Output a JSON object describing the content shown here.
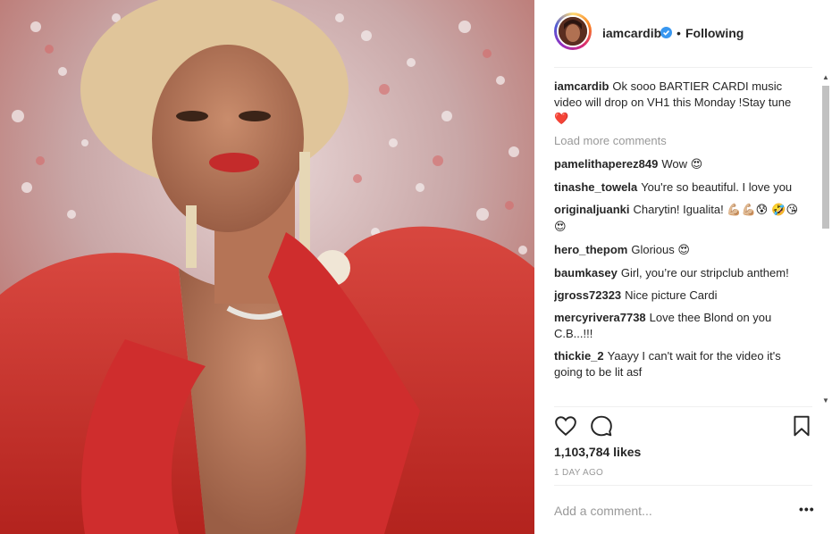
{
  "post": {
    "username": "iamcardib",
    "follow_status": "Following",
    "caption_user": "iamcardib",
    "caption_text": "Ok sooo BARTIER CARDI music video will drop on VH1 this Monday !Stay tune",
    "caption_emoji": "❤️",
    "load_more": "Load more comments",
    "likes": "1,103,784 likes",
    "time_ago": "1 DAY AGO",
    "add_comment_placeholder": "Add a comment...",
    "more_options": "•••"
  },
  "comments": [
    {
      "user": "pamelithaperez849",
      "text": "Wow",
      "emoji": "😍"
    },
    {
      "user": "tinashe_towela",
      "text": "You're so beautiful. I love you",
      "emoji": ""
    },
    {
      "user": "originaljuanki",
      "text": "Charytin! Igualita!",
      "emoji": "💪🏼💪🏼😰 🤣😘😍"
    },
    {
      "user": "hero_thepom",
      "text": "Glorious",
      "emoji": "😍"
    },
    {
      "user": "baumkasey",
      "text": "Girl, you’re our stripclub anthem!",
      "emoji": ""
    },
    {
      "user": "jgross72323",
      "text": "Nice picture Cardi",
      "emoji": ""
    },
    {
      "user": "mercyrivera7738",
      "text": "Love thee Blond on you C.B...!!!",
      "emoji": ""
    },
    {
      "user": "thickie_2",
      "text": "Yaayy I can't wait for the video it's going to be lit asf",
      "emoji": ""
    }
  ],
  "colors": {
    "verified_blue": "#3897f0",
    "heart_red": "#ed4956",
    "muted_gray": "#999999",
    "text_dark": "#262626"
  },
  "icons": {
    "like": "heart-outline-icon",
    "comment": "speech-bubble-icon",
    "save": "bookmark-icon",
    "verified": "verified-badge-icon"
  }
}
